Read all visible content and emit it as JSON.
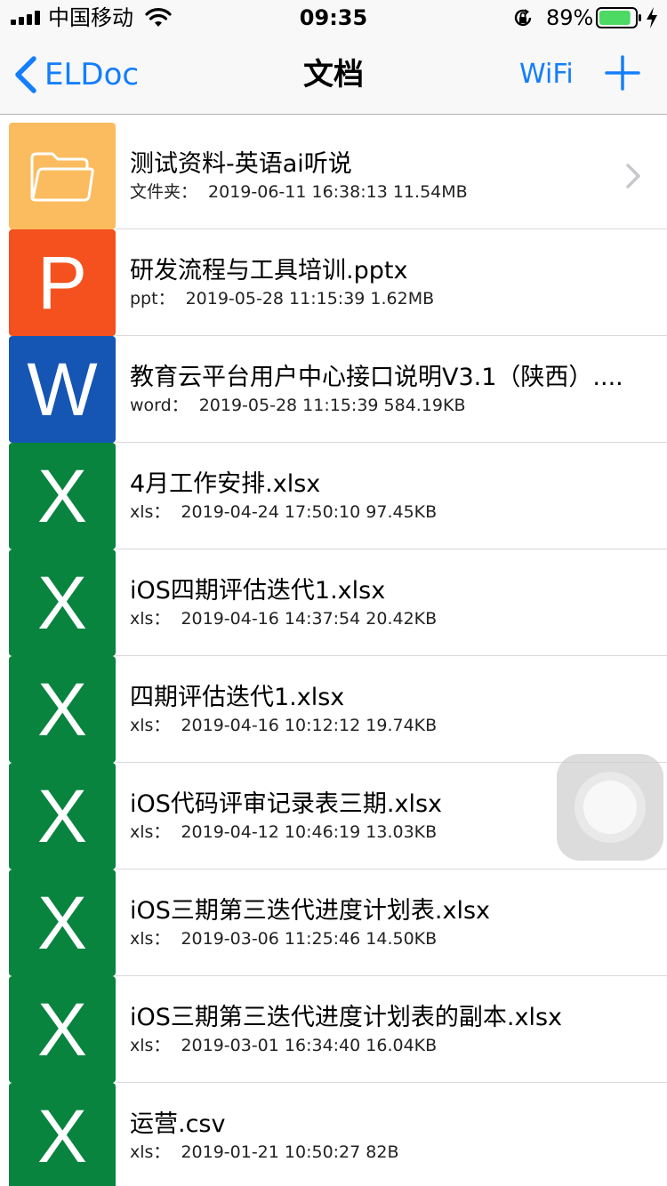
{
  "status_bar": {
    "carrier": "中国移动",
    "time": "09:35",
    "battery_percent": "89%",
    "battery_level": 0.89
  },
  "nav": {
    "back_label": "ELDoc",
    "title": "文档",
    "wifi_label": "WiFi"
  },
  "colors": {
    "accent": "#147efb",
    "folder": "#fbbc5f",
    "ppt": "#f4511e",
    "word": "#1555b4",
    "xls": "#08843f"
  },
  "files": [
    {
      "kind": "folder",
      "icon": "folder-icon",
      "name": "测试资料-英语ai听说",
      "type_label": "文件夹：",
      "details": "2019-06-11 16:38:13 11.54MB"
    },
    {
      "kind": "ppt",
      "icon": "ppt-icon",
      "letter": "P",
      "name": "研发流程与工具培训.pptx",
      "type_label": "ppt：",
      "details": "2019-05-28 11:15:39 1.62MB"
    },
    {
      "kind": "word",
      "icon": "word-icon",
      "letter": "W",
      "name": "教育云平台用户中心接口说明V3.1（陕西）....",
      "type_label": "word：",
      "details": "2019-05-28 11:15:39 584.19KB"
    },
    {
      "kind": "xls",
      "icon": "excel-icon",
      "letter": "X",
      "name": "4月工作安排.xlsx",
      "type_label": "xls：",
      "details": "2019-04-24 17:50:10 97.45KB"
    },
    {
      "kind": "xls",
      "icon": "excel-icon",
      "letter": "X",
      "name": "iOS四期评估迭代1.xlsx",
      "type_label": "xls：",
      "details": "2019-04-16 14:37:54 20.42KB"
    },
    {
      "kind": "xls",
      "icon": "excel-icon",
      "letter": "X",
      "name": "四期评估迭代1.xlsx",
      "type_label": "xls：",
      "details": "2019-04-16 10:12:12 19.74KB"
    },
    {
      "kind": "xls",
      "icon": "excel-icon",
      "letter": "X",
      "name": "iOS代码评审记录表三期.xlsx",
      "type_label": "xls：",
      "details": "2019-04-12 10:46:19 13.03KB"
    },
    {
      "kind": "xls",
      "icon": "excel-icon",
      "letter": "X",
      "name": "iOS三期第三迭代进度计划表.xlsx",
      "type_label": "xls：",
      "details": "2019-03-06 11:25:46 14.50KB"
    },
    {
      "kind": "xls",
      "icon": "excel-icon",
      "letter": "X",
      "name": "iOS三期第三迭代进度计划表的副本.xlsx",
      "type_label": "xls：",
      "details": "2019-03-01 16:34:40 16.04KB"
    },
    {
      "kind": "xls",
      "icon": "excel-icon",
      "letter": "X",
      "name": "运营.csv",
      "type_label": "xls：",
      "details": "2019-01-21 10:50:27 82B"
    }
  ]
}
